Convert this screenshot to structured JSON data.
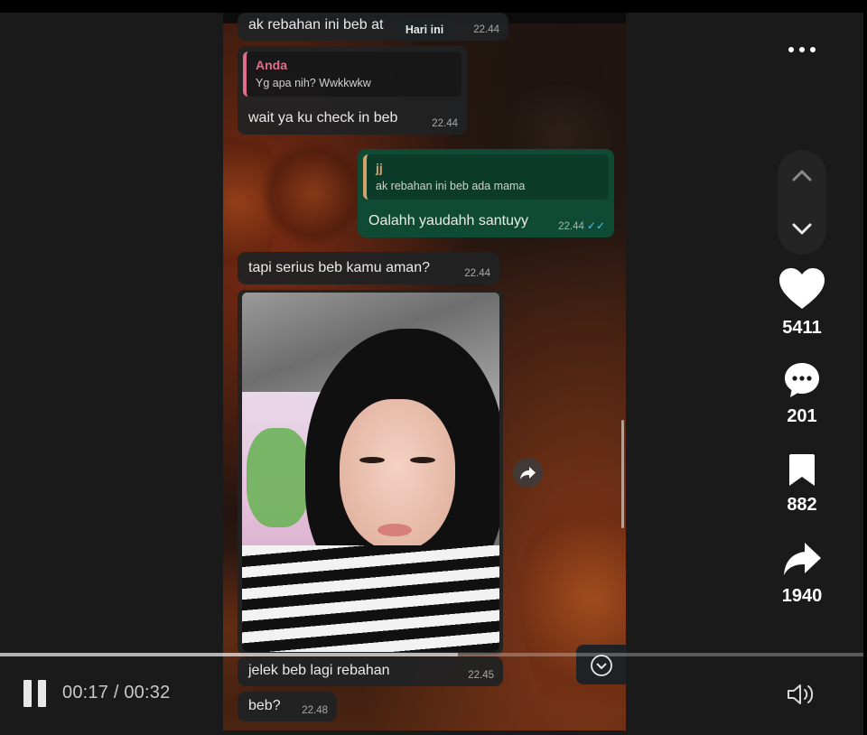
{
  "chat": {
    "date_chip": "Hari ini",
    "messages": [
      {
        "text": "ak rebahan ini beb at",
        "time": "22.44"
      },
      {
        "reply_name": "Anda",
        "reply_text": "Yg apa nih? Wwkkwkw",
        "text": "wait ya ku check in beb",
        "time": "22.44"
      },
      {
        "reply_name": "jj",
        "reply_text": "ak rebahan ini beb ada mama",
        "text": "Oalahh yaudahh santuyy",
        "time": "22.44",
        "ticks": "✓✓"
      },
      {
        "text": "tapi serius beb kamu aman?",
        "time": "22.44"
      },
      {
        "text": "jelek beb lagi rebahan",
        "time": "22.45"
      },
      {
        "text": "beb?",
        "time": "22.48"
      }
    ]
  },
  "player": {
    "current_time": "00:17",
    "duration": "00:32",
    "time_separator": " / ",
    "progress_fraction": 0.53
  },
  "actions": {
    "likes": "5411",
    "comments": "201",
    "saves": "882",
    "shares": "1940"
  },
  "icons": {
    "more": "more-horizontal-icon",
    "prev": "chevron-up-icon",
    "next": "chevron-down-icon",
    "like": "heart-icon",
    "comment": "comment-icon",
    "save": "bookmark-icon",
    "share": "share-icon",
    "pause": "pause-icon",
    "volume": "volume-icon",
    "forward": "forward-icon",
    "scroll_down": "scroll-down-icon"
  },
  "colors": {
    "outgoing_bubble": "#0f4b34",
    "incoming_bubble": "#202224",
    "reply_accent_in": "#e06e8a",
    "reply_accent_out": "#cfa36a",
    "read_ticks": "#53bdeb"
  }
}
